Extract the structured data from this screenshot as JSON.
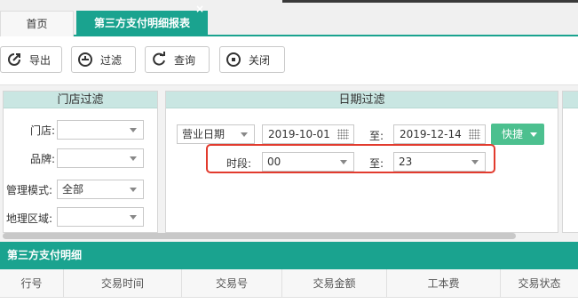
{
  "tabs": {
    "home": "首页",
    "active": "第三方支付明细报表",
    "close_glyph": "×"
  },
  "toolbar": {
    "export": "导出",
    "filter": "过滤",
    "query": "查询",
    "close": "关闭"
  },
  "store_filter": {
    "title": "门店过滤",
    "store_label": "门店:",
    "store_value": "",
    "brand_label": "品牌:",
    "brand_value": "",
    "mgmt_label": "管理模式:",
    "mgmt_value": "全部",
    "region_label": "地理区域:",
    "region_value": ""
  },
  "date_filter": {
    "title": "日期过滤",
    "date_type": "营业日期",
    "start_date": "2019-10-01",
    "to_label": "至:",
    "end_date": "2019-12-14",
    "quick_label": "快捷",
    "period_label": "时段:",
    "period_start": "00",
    "period_to_label": "至:",
    "period_end": "23"
  },
  "table": {
    "title": "第三方支付明细",
    "columns": [
      "行号",
      "交易时间",
      "交易号",
      "交易金额",
      "工本费",
      "交易状态"
    ]
  },
  "colors": {
    "accent": "#1aa38f",
    "panel_header": "#c9e6e2",
    "quick_button": "#4cc08f",
    "highlight": "#e23b2e"
  }
}
